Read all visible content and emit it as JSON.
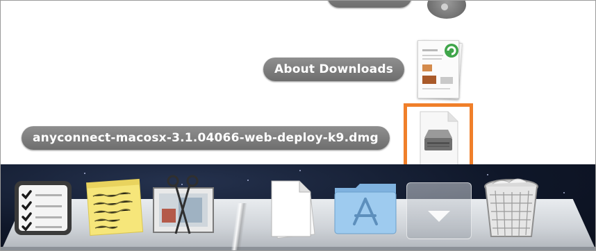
{
  "stack": {
    "items": [
      {
        "name": "About Downloads"
      },
      {
        "name": "anyconnect-macosx-3.1.04066-web-deploy-k9.dmg"
      }
    ]
  },
  "highlight_color": "#f07f2a",
  "dock": {
    "apps": [
      {
        "name": "Reminders",
        "icon": "reminders-icon"
      },
      {
        "name": "Stickies",
        "icon": "stickies-icon"
      },
      {
        "name": "Grab",
        "icon": "grab-icon"
      }
    ],
    "folders": [
      {
        "name": "Documents",
        "icon": "documents-folder-icon"
      },
      {
        "name": "Applications",
        "icon": "applications-folder-icon"
      },
      {
        "name": "Downloads",
        "icon": "downloads-stack-icon"
      },
      {
        "name": "Trash",
        "icon": "trash-icon"
      }
    ]
  }
}
